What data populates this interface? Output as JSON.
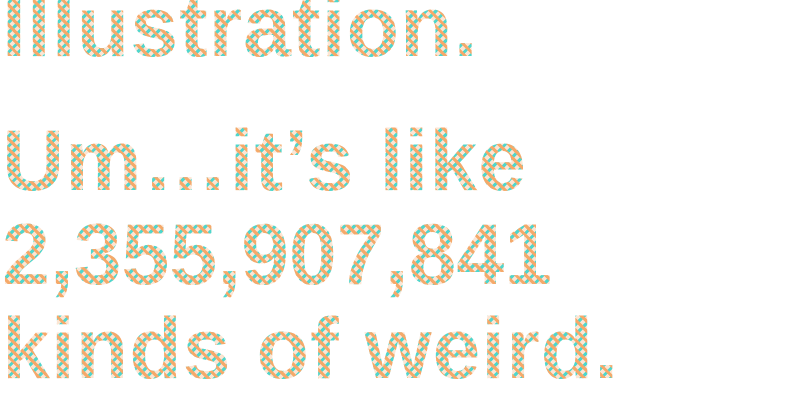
{
  "headline": {
    "line1": "Illustration.",
    "line2": "Um…it’s like",
    "line3": "2,355,907,841",
    "line4": "kinds of weird."
  },
  "colors": {
    "pattern_orange": "#f5a96a",
    "pattern_teal": "#4fd6cc",
    "background": "#ffffff"
  }
}
